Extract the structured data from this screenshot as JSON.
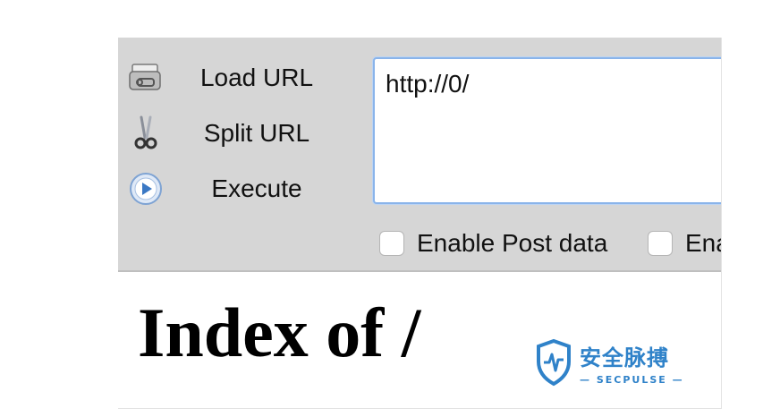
{
  "toolbar": {
    "items": [
      {
        "label": "Load URL",
        "icon": "load-url-icon"
      },
      {
        "label": "Split URL",
        "icon": "scissors-icon"
      },
      {
        "label": "Execute",
        "icon": "play-icon"
      }
    ],
    "url_value": "http://0/",
    "options": [
      {
        "label": "Enable Post data",
        "checked": false
      },
      {
        "label": "Ena",
        "checked": false
      }
    ]
  },
  "page": {
    "heading": "Index of /"
  },
  "watermark": {
    "text": "安全脉搏",
    "subtext": "— SECPULSE —"
  },
  "colors": {
    "toolbar_bg": "#d6d6d6",
    "url_border": "#8ab4ea",
    "watermark": "#2f82c9"
  }
}
